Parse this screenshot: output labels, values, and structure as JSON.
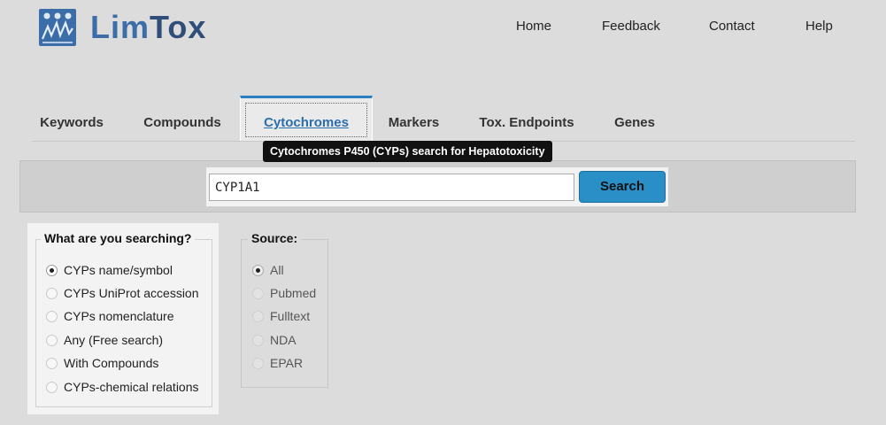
{
  "brand": {
    "name_part1": "Lim",
    "name_part2": "Tox"
  },
  "topnav": {
    "home": "Home",
    "feedback": "Feedback",
    "contact": "Contact",
    "help": "Help"
  },
  "tabs": [
    {
      "label": "Keywords",
      "active": false
    },
    {
      "label": "Compounds",
      "active": false
    },
    {
      "label": "Cytochromes",
      "active": true
    },
    {
      "label": "Markers",
      "active": false
    },
    {
      "label": "Tox. Endpoints",
      "active": false
    },
    {
      "label": "Genes",
      "active": false
    }
  ],
  "tooltip": "Cytochromes P450 (CYPs) search for Hepatotoxicity",
  "search": {
    "value": "CYP1A1",
    "button_label": "Search"
  },
  "what": {
    "legend": "What are you searching?",
    "options": [
      {
        "label": "CYPs name/symbol",
        "checked": true
      },
      {
        "label": "CYPs UniProt accession",
        "checked": false
      },
      {
        "label": "CYPs nomenclature",
        "checked": false
      },
      {
        "label": "Any (Free search)",
        "checked": false
      },
      {
        "label": "With Compounds",
        "checked": false
      },
      {
        "label": "CYPs-chemical relations",
        "checked": false
      }
    ]
  },
  "source": {
    "legend": "Source:",
    "options": [
      {
        "label": "All",
        "checked": true
      },
      {
        "label": "Pubmed",
        "checked": false
      },
      {
        "label": "Fulltext",
        "checked": false
      },
      {
        "label": "NDA",
        "checked": false
      },
      {
        "label": "EPAR",
        "checked": false
      }
    ]
  },
  "colors": {
    "accent": "#2a8fc7",
    "tab_active_text": "#2a6fad",
    "logo_blue": "#3b6ea8",
    "background": "#dcdcdc"
  }
}
